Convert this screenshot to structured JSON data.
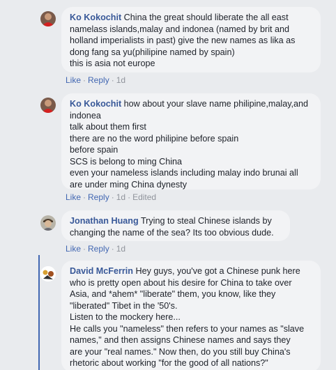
{
  "comments": [
    {
      "author": "Ko Kokochit",
      "lines": [
        "China the great should liberate the all east",
        "namelass islands,malay and indonea (named by brit and",
        "holland imperialists in past) give the new names as lika as",
        "dong fang sa yu(philipine named by spain)",
        "this is asia not europe"
      ],
      "actions": {
        "like": "Like",
        "reply": "Reply",
        "time": "1d",
        "edited": ""
      }
    },
    {
      "author": "Ko Kokochit",
      "lines": [
        "how about your slave name philipine,malay,and",
        "indonea",
        "talk about them first",
        "there are no the word philipine before spain",
        "before spain",
        "SCS is belong to ming China",
        "even your nameless islands including malay indo brunai all",
        "are under ming China dynesty"
      ],
      "actions": {
        "like": "Like",
        "reply": "Reply",
        "time": "1d",
        "edited": "Edited"
      }
    },
    {
      "author": "Jonathan Huang",
      "lines": [
        "Trying to steal Chinese islands by",
        "changing the name of the sea? Its too obvious dude."
      ],
      "actions": {
        "like": "Like",
        "reply": "Reply",
        "time": "1d",
        "edited": ""
      }
    },
    {
      "author": "David McFerrin",
      "lines": [
        "Hey guys, you've got a Chinese punk here",
        "who is pretty open about his desire for China to take over",
        "Asia, and *ahem* \"liberate\" them, you know, like they",
        "\"liberated\" Tibet in the '50's.",
        "Listen to the mockery here...",
        "He calls you \"nameless\" then refers to your names as \"slave",
        "names,\" and then assigns Chinese names and says they",
        "are your \"real names.\" Now then, do you still buy China's",
        "rhetoric about working \"for the good of all nations?\""
      ],
      "actions": null
    }
  ],
  "colors": {
    "background": "#e9ebee",
    "bubble": "#f2f3f5",
    "author": "#385898",
    "link": "#4267b2",
    "meta": "#90949c",
    "thread_line": "#4267b2"
  }
}
